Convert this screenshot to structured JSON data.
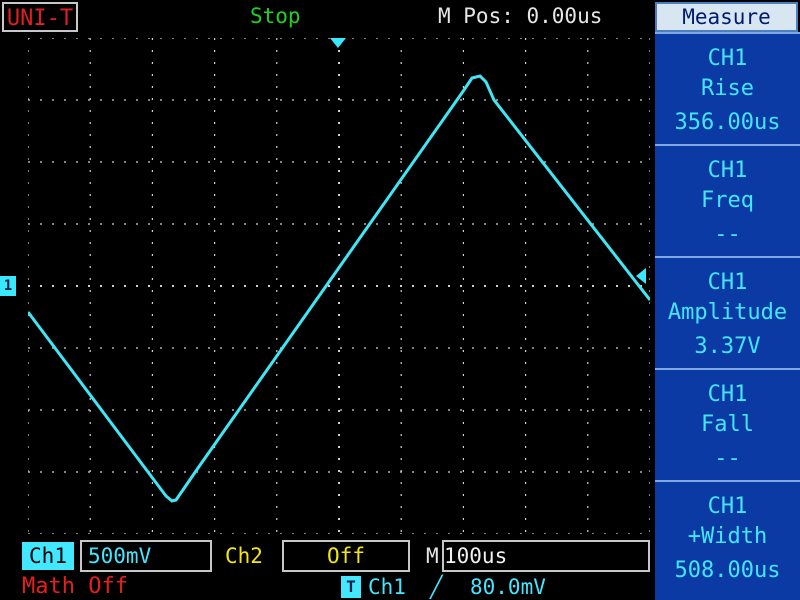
{
  "header": {
    "brand": "UNI-T",
    "run_state": "Stop",
    "m_pos": "M Pos: 0.00us",
    "menu_title": "Measure"
  },
  "measurements": [
    {
      "channel": "CH1",
      "label": "Rise",
      "value": "356.00us"
    },
    {
      "channel": "CH1",
      "label": "Freq",
      "value": "--"
    },
    {
      "channel": "CH1",
      "label": "Amplitude",
      "value": "3.37V"
    },
    {
      "channel": "CH1",
      "label": "Fall",
      "value": "--"
    },
    {
      "channel": "CH1",
      "label": "+Width",
      "value": "508.00us"
    }
  ],
  "screen": {
    "ch1_marker": "1",
    "grid_color": "#d0d0d0",
    "trace_color": "#3fe6f5"
  },
  "bottom": {
    "ch1_label": "Ch1",
    "ch1_scale": "500mV",
    "ch2_label": "Ch2",
    "ch2_scale": "Off",
    "m_label": "M",
    "timebase": "100us",
    "math": "Math Off",
    "trigger_icon": "T",
    "trigger_source": "Ch1",
    "trigger_edge": "╱",
    "trigger_level": "80.0mV"
  },
  "colors": {
    "accent_cyan": "#42e8ff",
    "status_green": "#1fd31f",
    "ch2_yellow": "#f4e70f",
    "math_red": "#e81e1e",
    "panel_blue": "#0b3aa5"
  }
}
